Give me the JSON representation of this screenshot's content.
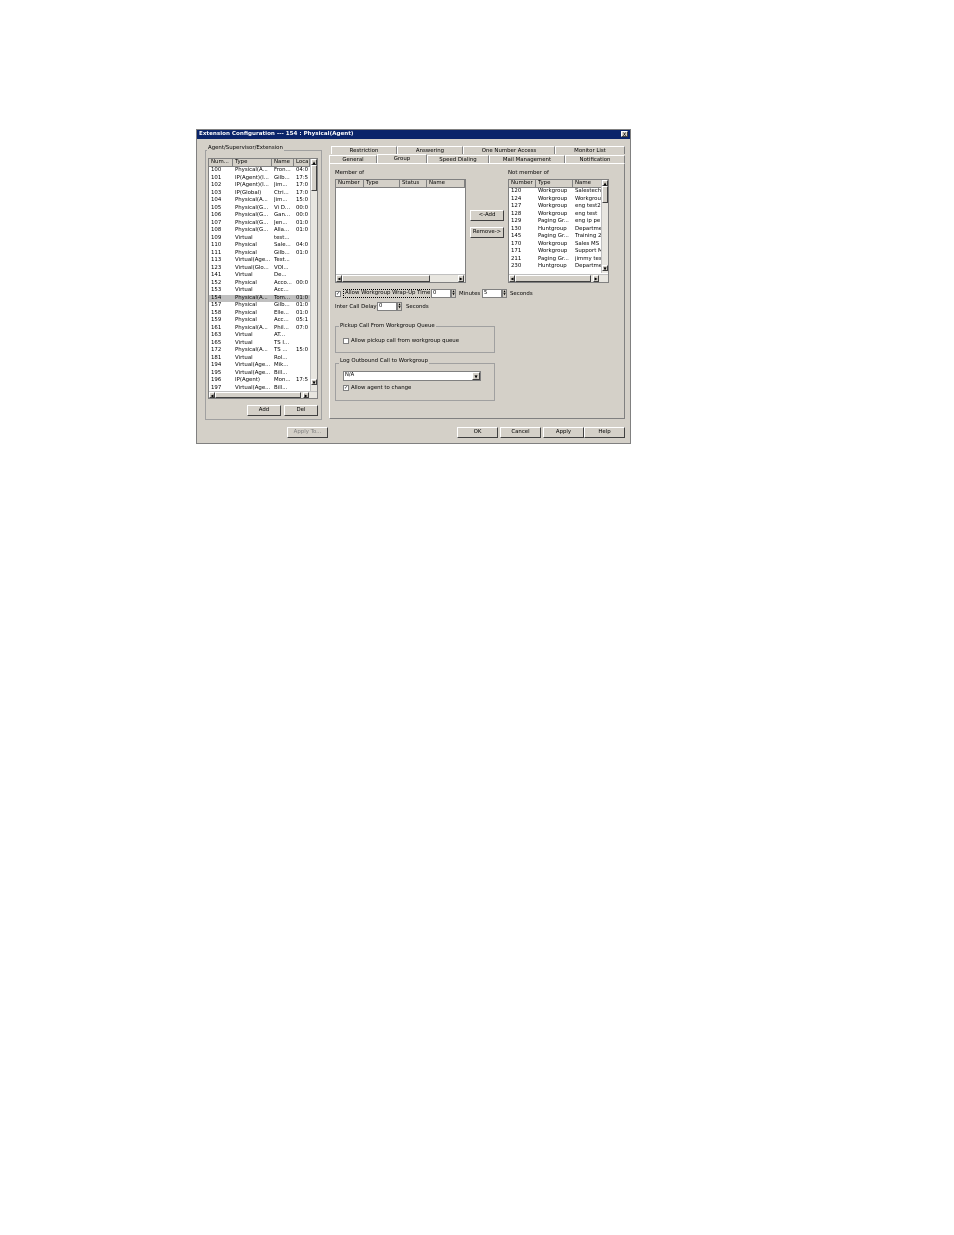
{
  "window": {
    "title": "Extension Configuration --- 154 : Physical(Agent)",
    "close_label": "x"
  },
  "left_panel": {
    "group_title": "Agent/Supervisor/Extension",
    "columns": [
      "Num...",
      "Type",
      "Name",
      "Loca"
    ],
    "rows": [
      [
        "100",
        "Physical(A...",
        "Fron...",
        "04:0"
      ],
      [
        "101",
        "IP(Agent)(I...",
        "Gilb...",
        "17:5"
      ],
      [
        "102",
        "IP(Agent)(I...",
        "Jim...",
        "17:0"
      ],
      [
        "103",
        "IP(Global)",
        "Ctri...",
        "17:0"
      ],
      [
        "104",
        "Physical(A...",
        "Jim...",
        "15:0"
      ],
      [
        "105",
        "Physical(G...",
        "Vi D...",
        "00:0"
      ],
      [
        "106",
        "Physical(G...",
        "Gan...",
        "00:0"
      ],
      [
        "107",
        "Physical(G...",
        "Jen...",
        "01:0"
      ],
      [
        "108",
        "Physical(G...",
        "Alla...",
        "01:0"
      ],
      [
        "109",
        "Virtual",
        "test...",
        ""
      ],
      [
        "110",
        "Physical",
        "Sale...",
        "04:0"
      ],
      [
        "111",
        "Physical",
        "Gilb...",
        "01:0"
      ],
      [
        "113",
        "Virtual(Age...",
        "Test...",
        ""
      ],
      [
        "123",
        "Virtual(Glo...",
        "VOI...",
        ""
      ],
      [
        "141",
        "Virtual",
        "De...",
        ""
      ],
      [
        "152",
        "Physical",
        "Acco...",
        "00:0"
      ],
      [
        "153",
        "Virtual",
        "Acc...",
        ""
      ],
      [
        "154",
        "Physical(A...",
        "Tom...",
        "01:0"
      ],
      [
        "157",
        "Physical",
        "Gilb...",
        "01:0"
      ],
      [
        "158",
        "Physical",
        "Elle...",
        "01:0"
      ],
      [
        "159",
        "Physical",
        "Acc...",
        "05:1"
      ],
      [
        "161",
        "Physical(A...",
        "Phil...",
        "07:0"
      ],
      [
        "163",
        "Virtual",
        "AT...",
        ""
      ],
      [
        "165",
        "Virtual",
        "TS I...",
        ""
      ],
      [
        "172",
        "Physical(A...",
        "TS ...",
        "15:0"
      ],
      [
        "181",
        "Virtual",
        "Rol...",
        ""
      ],
      [
        "194",
        "Virtual(Age...",
        "Mik...",
        ""
      ],
      [
        "195",
        "Virtual(Age...",
        "Bill...",
        ""
      ],
      [
        "196",
        "IP(Agent)",
        "Mon...",
        "17:5"
      ],
      [
        "197",
        "Virtual(Age...",
        "Bill...",
        ""
      ]
    ],
    "selected_row": "154",
    "add_label": "Add",
    "del_label": "Del",
    "apply_to_label": "Apply To..."
  },
  "tabs": {
    "row_back": [
      "Restriction",
      "Answering",
      "One Number Access",
      "Monitor List"
    ],
    "row_front": [
      "General",
      "Group",
      "Speed Dialing",
      "Mail Management",
      "Notification"
    ],
    "active": "Group"
  },
  "group_tab": {
    "member_of_label": "Member of",
    "member_columns": [
      "Number",
      "Type",
      "Status",
      "Name"
    ],
    "not_member_label": "Not member of",
    "not_member_columns": [
      "Number",
      "Type",
      "Name"
    ],
    "not_member_rows": [
      [
        "120",
        "Workgroup",
        "Salestech"
      ],
      [
        "124",
        "Workgroup",
        "Workgrou"
      ],
      [
        "127",
        "Workgroup",
        "eng test2"
      ],
      [
        "128",
        "Workgroup",
        "eng test"
      ],
      [
        "129",
        "Paging Gr...",
        "eng ip pe"
      ],
      [
        "130",
        "Huntgroup",
        "Departme"
      ],
      [
        "145",
        "Paging Gr...",
        "Training 2"
      ],
      [
        "170",
        "Workgroup",
        "Sales MS"
      ],
      [
        "171",
        "Workgroup",
        "Support M"
      ],
      [
        "211",
        "Paging Gr...",
        "jimmy test"
      ],
      [
        "230",
        "Huntgroup",
        "Departme"
      ]
    ],
    "add_btn": "<-Add",
    "remove_btn": "Remove->",
    "wrapup_label": "Allow Workgroup Wrap-Up Time",
    "wrapup_checked": true,
    "wrapup_minutes": "0",
    "minutes_label": "Minutes",
    "wrapup_seconds": "5",
    "seconds_label": "Seconds",
    "inter_call_label": "Inter Call Delay",
    "inter_call_value": "0",
    "inter_call_seconds_label": "Seconds",
    "pickup_group_title": "Pickup Call From Workgroup Queue",
    "pickup_label": "Allow pickup call from workgroup queue",
    "pickup_checked": false,
    "log_group_title": "Log Outbound Call to Workgroup",
    "log_value": "N/A",
    "allow_change_label": "Allow agent to change",
    "allow_change_checked": true
  },
  "footer": {
    "ok": "OK",
    "cancel": "Cancel",
    "apply": "Apply",
    "help": "Help"
  }
}
